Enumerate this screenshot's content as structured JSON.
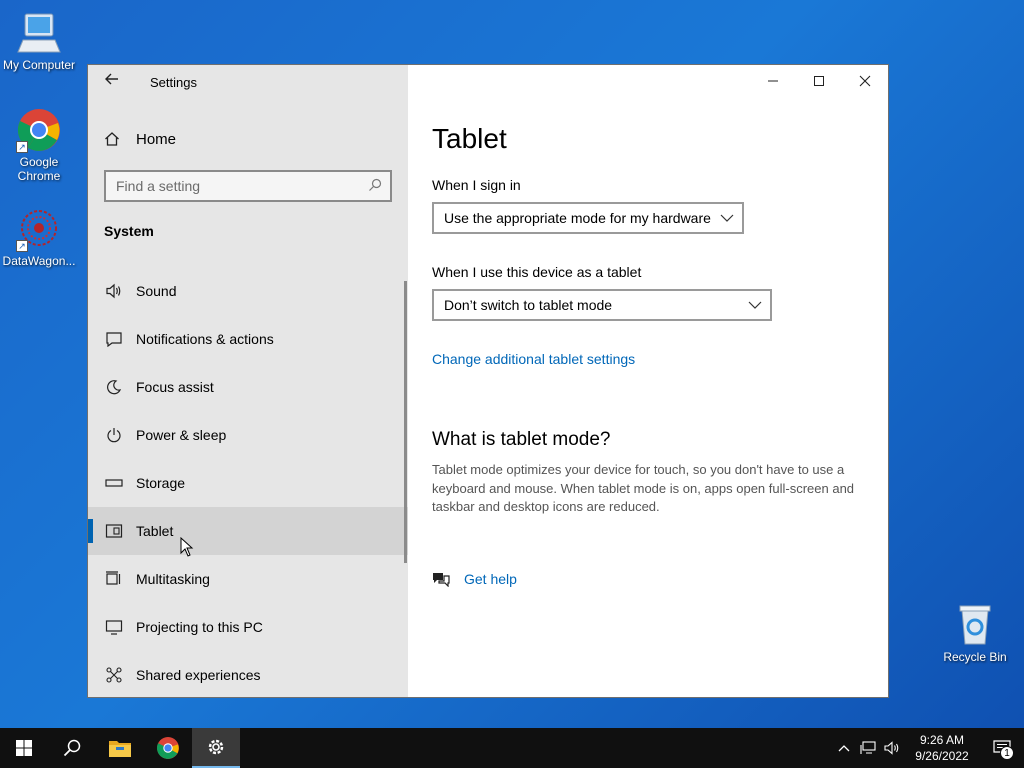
{
  "desktop": {
    "icons": [
      {
        "label": "My Computer",
        "icon": "computer-icon"
      },
      {
        "label": "Google Chrome",
        "icon": "chrome-icon"
      },
      {
        "label": "DataWagon...",
        "icon": "datawagon-icon"
      },
      {
        "label": "Recycle Bin",
        "icon": "recycle-bin-icon"
      }
    ]
  },
  "window": {
    "title": "Settings",
    "back_icon": "back-arrow-icon",
    "controls": {
      "minimize": "minimize-icon",
      "maximize": "maximize-icon",
      "close": "close-icon"
    }
  },
  "sidebar": {
    "home_label": "Home",
    "search_placeholder": "Find a setting",
    "section_label": "System",
    "items": [
      {
        "label": "Sound",
        "icon": "speaker-icon",
        "active": false
      },
      {
        "label": "Notifications & actions",
        "icon": "notification-icon",
        "active": false
      },
      {
        "label": "Focus assist",
        "icon": "moon-icon",
        "active": false
      },
      {
        "label": "Power & sleep",
        "icon": "power-icon",
        "active": false
      },
      {
        "label": "Storage",
        "icon": "storage-icon",
        "active": false
      },
      {
        "label": "Tablet",
        "icon": "tablet-icon",
        "active": true
      },
      {
        "label": "Multitasking",
        "icon": "multitasking-icon",
        "active": false
      },
      {
        "label": "Projecting to this PC",
        "icon": "projecting-icon",
        "active": false
      },
      {
        "label": "Shared experiences",
        "icon": "shared-experiences-icon",
        "active": false
      }
    ]
  },
  "main": {
    "title": "Tablet",
    "sign_in_label": "When I sign in",
    "sign_in_value": "Use the appropriate mode for my hardware",
    "tablet_use_label": "When I use this device as a tablet",
    "tablet_use_value": "Don’t switch to tablet mode",
    "additional_link": "Change additional tablet settings",
    "what_is_heading": "What is tablet mode?",
    "what_is_text": "Tablet mode optimizes your device for touch, so you don't have to use a keyboard and mouse. When tablet mode is on, apps open full-screen and taskbar and desktop icons are reduced.",
    "get_help": "Get help"
  },
  "taskbar": {
    "items": [
      "start-icon",
      "search-icon",
      "file-explorer-icon",
      "chrome-icon",
      "settings-icon"
    ],
    "active": "settings-icon",
    "clock_time": "9:26 AM",
    "clock_date": "9/26/2022",
    "notification_count": "1"
  },
  "colors": {
    "accent": "#0063b1",
    "link": "#0067b8",
    "taskbar": "#101010",
    "sidebar": "#e6e6e6"
  }
}
